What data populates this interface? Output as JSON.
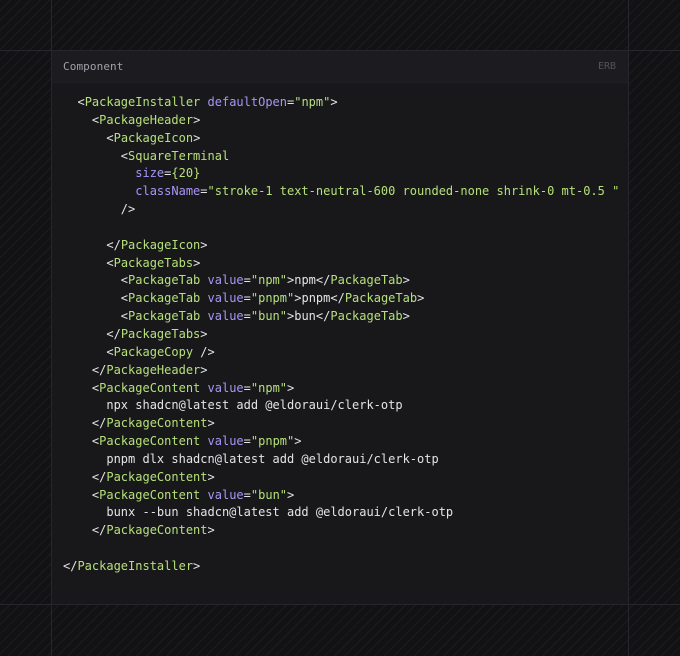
{
  "header": {
    "title": "Component",
    "language": "ERB"
  },
  "code_lines": [
    {
      "segs": [
        {
          "k": "ws",
          "v": "  "
        },
        {
          "k": "p",
          "v": "<"
        },
        {
          "k": "t",
          "v": "PackageInstaller"
        },
        {
          "k": "p",
          "v": " "
        },
        {
          "k": "a",
          "v": "defaultOpen"
        },
        {
          "k": "p",
          "v": "="
        },
        {
          "k": "s",
          "v": "\"npm\""
        },
        {
          "k": "p",
          "v": ">"
        }
      ]
    },
    {
      "segs": [
        {
          "k": "ws",
          "v": "    "
        },
        {
          "k": "p",
          "v": "<"
        },
        {
          "k": "t",
          "v": "PackageHeader"
        },
        {
          "k": "p",
          "v": ">"
        }
      ]
    },
    {
      "segs": [
        {
          "k": "ws",
          "v": "      "
        },
        {
          "k": "p",
          "v": "<"
        },
        {
          "k": "t",
          "v": "PackageIcon"
        },
        {
          "k": "p",
          "v": ">"
        }
      ]
    },
    {
      "segs": [
        {
          "k": "ws",
          "v": "        "
        },
        {
          "k": "p",
          "v": "<"
        },
        {
          "k": "t",
          "v": "SquareTerminal"
        }
      ]
    },
    {
      "segs": [
        {
          "k": "ws",
          "v": "          "
        },
        {
          "k": "a",
          "v": "size"
        },
        {
          "k": "p",
          "v": "="
        },
        {
          "k": "s",
          "v": "{20}"
        }
      ]
    },
    {
      "segs": [
        {
          "k": "ws",
          "v": "          "
        },
        {
          "k": "a",
          "v": "className"
        },
        {
          "k": "p",
          "v": "="
        },
        {
          "k": "s",
          "v": "\"stroke-1 text-neutral-600 rounded-none shrink-0 mt-0.5 \""
        }
      ]
    },
    {
      "segs": [
        {
          "k": "ws",
          "v": "        "
        },
        {
          "k": "p",
          "v": "/>"
        }
      ]
    },
    {
      "segs": []
    },
    {
      "segs": [
        {
          "k": "ws",
          "v": "      "
        },
        {
          "k": "p",
          "v": "</"
        },
        {
          "k": "t",
          "v": "PackageIcon"
        },
        {
          "k": "p",
          "v": ">"
        }
      ]
    },
    {
      "segs": [
        {
          "k": "ws",
          "v": "      "
        },
        {
          "k": "p",
          "v": "<"
        },
        {
          "k": "t",
          "v": "PackageTabs"
        },
        {
          "k": "p",
          "v": ">"
        }
      ]
    },
    {
      "segs": [
        {
          "k": "ws",
          "v": "        "
        },
        {
          "k": "p",
          "v": "<"
        },
        {
          "k": "t",
          "v": "PackageTab"
        },
        {
          "k": "p",
          "v": " "
        },
        {
          "k": "a",
          "v": "value"
        },
        {
          "k": "p",
          "v": "="
        },
        {
          "k": "s",
          "v": "\"npm\""
        },
        {
          "k": "p",
          "v": ">"
        },
        {
          "k": "tx",
          "v": "npm"
        },
        {
          "k": "p",
          "v": "</"
        },
        {
          "k": "t",
          "v": "PackageTab"
        },
        {
          "k": "p",
          "v": ">"
        }
      ]
    },
    {
      "segs": [
        {
          "k": "ws",
          "v": "        "
        },
        {
          "k": "p",
          "v": "<"
        },
        {
          "k": "t",
          "v": "PackageTab"
        },
        {
          "k": "p",
          "v": " "
        },
        {
          "k": "a",
          "v": "value"
        },
        {
          "k": "p",
          "v": "="
        },
        {
          "k": "s",
          "v": "\"pnpm\""
        },
        {
          "k": "p",
          "v": ">"
        },
        {
          "k": "tx",
          "v": "pnpm"
        },
        {
          "k": "p",
          "v": "</"
        },
        {
          "k": "t",
          "v": "PackageTab"
        },
        {
          "k": "p",
          "v": ">"
        }
      ]
    },
    {
      "segs": [
        {
          "k": "ws",
          "v": "        "
        },
        {
          "k": "p",
          "v": "<"
        },
        {
          "k": "t",
          "v": "PackageTab"
        },
        {
          "k": "p",
          "v": " "
        },
        {
          "k": "a",
          "v": "value"
        },
        {
          "k": "p",
          "v": "="
        },
        {
          "k": "s",
          "v": "\"bun\""
        },
        {
          "k": "p",
          "v": ">"
        },
        {
          "k": "tx",
          "v": "bun"
        },
        {
          "k": "p",
          "v": "</"
        },
        {
          "k": "t",
          "v": "PackageTab"
        },
        {
          "k": "p",
          "v": ">"
        }
      ]
    },
    {
      "segs": [
        {
          "k": "ws",
          "v": "      "
        },
        {
          "k": "p",
          "v": "</"
        },
        {
          "k": "t",
          "v": "PackageTabs"
        },
        {
          "k": "p",
          "v": ">"
        }
      ]
    },
    {
      "segs": [
        {
          "k": "ws",
          "v": "      "
        },
        {
          "k": "p",
          "v": "<"
        },
        {
          "k": "t",
          "v": "PackageCopy"
        },
        {
          "k": "p",
          "v": " />"
        }
      ]
    },
    {
      "segs": [
        {
          "k": "ws",
          "v": "    "
        },
        {
          "k": "p",
          "v": "</"
        },
        {
          "k": "t",
          "v": "PackageHeader"
        },
        {
          "k": "p",
          "v": ">"
        }
      ]
    },
    {
      "segs": [
        {
          "k": "ws",
          "v": "    "
        },
        {
          "k": "p",
          "v": "<"
        },
        {
          "k": "t",
          "v": "PackageContent"
        },
        {
          "k": "p",
          "v": " "
        },
        {
          "k": "a",
          "v": "value"
        },
        {
          "k": "p",
          "v": "="
        },
        {
          "k": "s",
          "v": "\"npm\""
        },
        {
          "k": "p",
          "v": ">"
        }
      ]
    },
    {
      "segs": [
        {
          "k": "ws",
          "v": "      "
        },
        {
          "k": "tx",
          "v": "npx shadcn@latest add @eldoraui/clerk-otp"
        }
      ]
    },
    {
      "segs": [
        {
          "k": "ws",
          "v": "    "
        },
        {
          "k": "p",
          "v": "</"
        },
        {
          "k": "t",
          "v": "PackageContent"
        },
        {
          "k": "p",
          "v": ">"
        }
      ]
    },
    {
      "segs": [
        {
          "k": "ws",
          "v": "    "
        },
        {
          "k": "p",
          "v": "<"
        },
        {
          "k": "t",
          "v": "PackageContent"
        },
        {
          "k": "p",
          "v": " "
        },
        {
          "k": "a",
          "v": "value"
        },
        {
          "k": "p",
          "v": "="
        },
        {
          "k": "s",
          "v": "\"pnpm\""
        },
        {
          "k": "p",
          "v": ">"
        }
      ]
    },
    {
      "segs": [
        {
          "k": "ws",
          "v": "      "
        },
        {
          "k": "tx",
          "v": "pnpm dlx shadcn@latest add @eldoraui/clerk-otp"
        }
      ]
    },
    {
      "segs": [
        {
          "k": "ws",
          "v": "    "
        },
        {
          "k": "p",
          "v": "</"
        },
        {
          "k": "t",
          "v": "PackageContent"
        },
        {
          "k": "p",
          "v": ">"
        }
      ]
    },
    {
      "segs": [
        {
          "k": "ws",
          "v": "    "
        },
        {
          "k": "p",
          "v": "<"
        },
        {
          "k": "t",
          "v": "PackageContent"
        },
        {
          "k": "p",
          "v": " "
        },
        {
          "k": "a",
          "v": "value"
        },
        {
          "k": "p",
          "v": "="
        },
        {
          "k": "s",
          "v": "\"bun\""
        },
        {
          "k": "p",
          "v": ">"
        }
      ]
    },
    {
      "segs": [
        {
          "k": "ws",
          "v": "      "
        },
        {
          "k": "tx",
          "v": "bunx --bun shadcn@latest add @eldoraui/clerk-otp"
        }
      ]
    },
    {
      "segs": [
        {
          "k": "ws",
          "v": "    "
        },
        {
          "k": "p",
          "v": "</"
        },
        {
          "k": "t",
          "v": "PackageContent"
        },
        {
          "k": "p",
          "v": ">"
        }
      ]
    },
    {
      "segs": []
    },
    {
      "segs": [
        {
          "k": "p",
          "v": "</"
        },
        {
          "k": "t",
          "v": "PackageInstaller"
        },
        {
          "k": "p",
          "v": ">"
        }
      ]
    }
  ],
  "colors": {
    "background": "#121214",
    "panel": "#18181b",
    "panel_header": "#1c1c20",
    "tag": "#b5e07a",
    "attribute": "#a895f5",
    "string": "#b5e07a",
    "text": "#e4e4e7"
  }
}
